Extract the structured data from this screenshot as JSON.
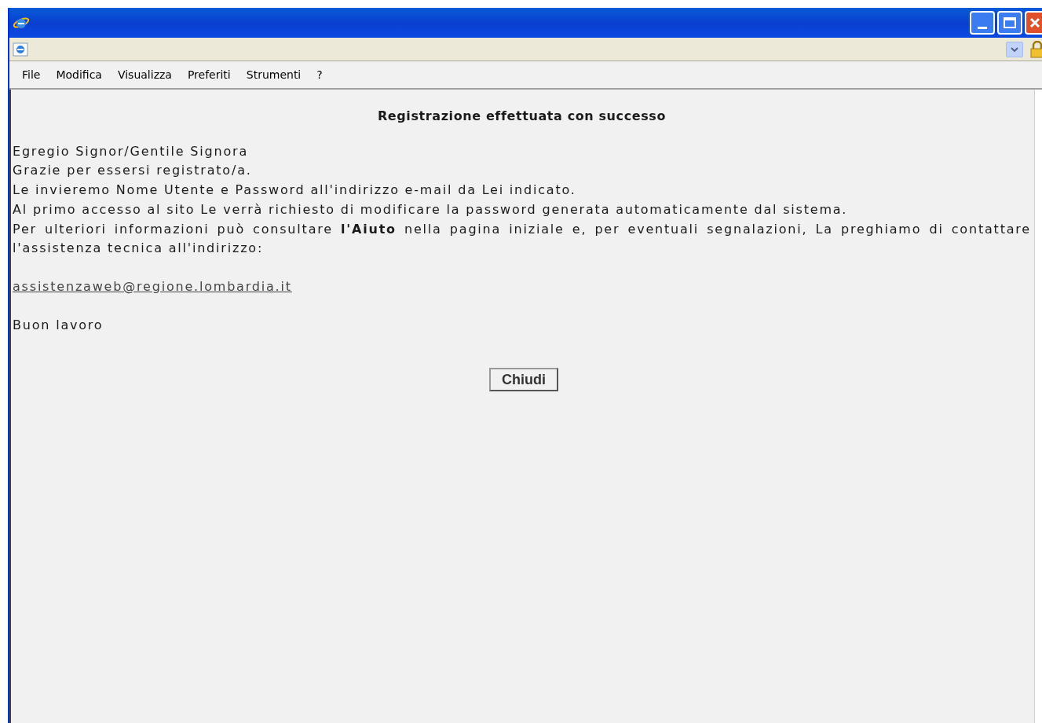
{
  "menu": [
    "File",
    "Modifica",
    "Visualizza",
    "Preferiti",
    "Strumenti",
    "?"
  ],
  "page": {
    "heading": "Registrazione effettuata con successo",
    "lines": [
      "Egregio Signor/Gentile Signora",
      "Grazie per essersi registrato/a.",
      "Le invieremo Nome Utente e Password all'indirizzo e-mail da Lei indicato.",
      "Al primo accesso al sito Le verrà richiesto di modificare la password generata automaticamente dal sistema."
    ],
    "paragraph": "Per ulteriori informazioni può consultare **l'Aiuto** nella pagina iniziale e, per eventuali segnalazioni, La preghiamo di contattare l'assistenza tecnica all'indirizzo:",
    "email": "assistenzaweb@regione.lombardia.it",
    "closing": "Buon lavoro",
    "button": "Chiudi"
  }
}
